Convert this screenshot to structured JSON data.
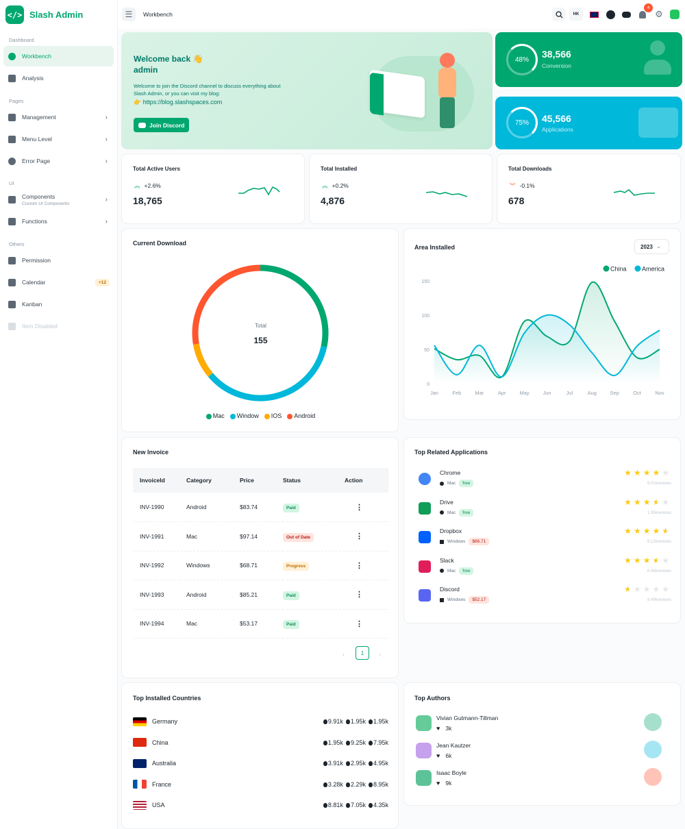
{
  "app": {
    "name": "Slash Admin",
    "logo_glyph": "</>"
  },
  "sidebar": {
    "sections": [
      {
        "label": "Dashboard"
      },
      {
        "label": "Pages"
      },
      {
        "label": "UI"
      },
      {
        "label": "Others"
      }
    ],
    "items": [
      {
        "label": "Workbench",
        "active": true
      },
      {
        "label": "Analysis"
      },
      {
        "label": "Management",
        "chevron": true
      },
      {
        "label": "Menu Level",
        "chevron": true
      },
      {
        "label": "Error Page",
        "chevron": true
      },
      {
        "label": "Components",
        "caption": "Custom UI Components",
        "chevron": true
      },
      {
        "label": "Functions",
        "chevron": true
      },
      {
        "label": "Permission"
      },
      {
        "label": "Calendar",
        "badge": "+12"
      },
      {
        "label": "Kanban"
      },
      {
        "label": "Item Disabled",
        "disabled": true
      }
    ]
  },
  "header": {
    "breadcrumb": "Workbench",
    "lang_code": "HK",
    "notification_count": "4"
  },
  "welcome": {
    "title_line1": "Welcome back 👋",
    "title_line2": "admin",
    "text": "Welcome to join the Discord channel to discuss everything about Slash Admin, or you can visit my blog:",
    "link": "👉 https://blog.slashspaces.com",
    "button": "Join Discord"
  },
  "stats": [
    {
      "percent": "48%",
      "value": "38,566",
      "label": "Conversion",
      "color": "#00a76f"
    },
    {
      "percent": "75%",
      "value": "45,566",
      "label": "Applications",
      "color": "#00b8d9"
    }
  ],
  "totals": [
    {
      "title": "Total Active Users",
      "change": "+2.6%",
      "value": "18,765",
      "trend": "up"
    },
    {
      "title": "Total Installed",
      "change": "+0.2%",
      "value": "4,876",
      "trend": "up"
    },
    {
      "title": "Total Downloads",
      "change": "-0.1%",
      "value": "678",
      "trend": "down"
    }
  ],
  "current_download": {
    "title": "Current Download",
    "total_label": "Total",
    "total": "155",
    "legend": [
      {
        "name": "Mac",
        "color": "#00a76f"
      },
      {
        "name": "Window",
        "color": "#00b8d9"
      },
      {
        "name": "IOS",
        "color": "#ffab00"
      },
      {
        "name": "Android",
        "color": "#ff5630"
      }
    ]
  },
  "area_installed": {
    "title": "Area Installed",
    "year": "2023"
  },
  "chart_data": [
    {
      "type": "pie",
      "title": "Current Download",
      "categories": [
        "Mac",
        "Window",
        "IOS",
        "Android"
      ],
      "values": [
        44,
        55,
        13,
        43
      ],
      "colors": [
        "#00a76f",
        "#00b8d9",
        "#ffab00",
        "#ff5630"
      ]
    },
    {
      "type": "area",
      "title": "Area Installed",
      "categories": [
        "Jan",
        "Feb",
        "Mar",
        "Apr",
        "May",
        "Jun",
        "Jul",
        "Aug",
        "Sep",
        "Oct",
        "Nov"
      ],
      "ylim": [
        0,
        150
      ],
      "yticks": [
        0,
        50,
        100,
        150
      ],
      "legend_position": "top-right",
      "series": [
        {
          "name": "China",
          "color": "#00a76f",
          "values": [
            51,
            35,
            41,
            10,
            91,
            69,
            62,
            148,
            91,
            38,
            50
          ]
        },
        {
          "name": "America",
          "color": "#00b8d9",
          "values": [
            56,
            13,
            56,
            10,
            74,
            100,
            86,
            45,
            12,
            55,
            78
          ]
        }
      ]
    }
  ],
  "invoice": {
    "title": "New Invoice",
    "headers": [
      "InvoiceId",
      "Category",
      "Price",
      "Status",
      "Action"
    ],
    "rows": [
      {
        "id": "INV-1990",
        "category": "Android",
        "price": "$83.74",
        "status": "Paid"
      },
      {
        "id": "INV-1991",
        "category": "Mac",
        "price": "$97.14",
        "status": "Out of Date"
      },
      {
        "id": "INV-1992",
        "category": "Windows",
        "price": "$68.71",
        "status": "Progress"
      },
      {
        "id": "INV-1993",
        "category": "Android",
        "price": "$85.21",
        "status": "Paid"
      },
      {
        "id": "INV-1994",
        "category": "Mac",
        "price": "$53.17",
        "status": "Paid"
      }
    ],
    "page": "1"
  },
  "top_apps": {
    "title": "Top Related Applications",
    "items": [
      {
        "name": "Chrome",
        "os": "Mac",
        "price": "free",
        "rating": 4,
        "reviews": "9.91kreviews",
        "color": "#4285f4"
      },
      {
        "name": "Drive",
        "os": "Mac",
        "price": "free",
        "rating": 3.5,
        "reviews": "1.95kreviews",
        "color": "#0f9d58"
      },
      {
        "name": "Dropbox",
        "os": "Windows",
        "price": "$66.71",
        "rating": 4.5,
        "reviews": "9.12kreviews",
        "color": "#0061ff"
      },
      {
        "name": "Slack",
        "os": "Mac",
        "price": "free",
        "rating": 3.5,
        "reviews": "6.98kreviews",
        "color": "#e01e5a"
      },
      {
        "name": "Discord",
        "os": "Windows",
        "price": "$52.17",
        "rating": 0.5,
        "reviews": "8.49kreviews",
        "color": "#5865f2"
      }
    ]
  },
  "countries": {
    "title": "Top Installed Countries",
    "items": [
      {
        "name": "Germany",
        "android": "9.91k",
        "windows": "1.95k",
        "ios": "1.95k"
      },
      {
        "name": "China",
        "android": "1.95k",
        "windows": "9.25k",
        "ios": "7.95k"
      },
      {
        "name": "Australia",
        "android": "3.91k",
        "windows": "2.95k",
        "ios": "4.95k"
      },
      {
        "name": "France",
        "android": "3.28k",
        "windows": "2.29k",
        "ios": "8.95k"
      },
      {
        "name": "USA",
        "android": "8.81k",
        "windows": "7.05k",
        "ios": "4.35k"
      }
    ]
  },
  "authors": {
    "title": "Top Authors",
    "items": [
      {
        "name": "Vivian Gutmann-Tillman",
        "likes": "3k",
        "trophy_color": "#00a76f"
      },
      {
        "name": "Jean Kautzer",
        "likes": "6k",
        "trophy_color": "#00b8d9"
      },
      {
        "name": "Isaac Boyle",
        "likes": "9k",
        "trophy_color": "#ff5630"
      }
    ]
  }
}
